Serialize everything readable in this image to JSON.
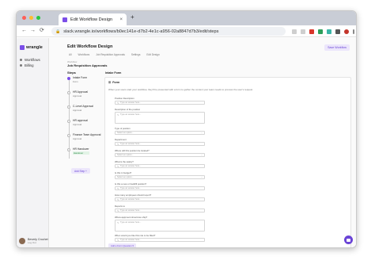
{
  "browser": {
    "tab_title": "Edit Workflow Design",
    "tab_close": "×",
    "new_tab": "+",
    "url": "slack.wrangle.io/workflows/b0ec141e-d7b2-4e1c-a956-02a8847d7b3/edit/steps",
    "back": "←",
    "forward": "→",
    "reload": "⟳",
    "lock": "🔒",
    "colors": {
      "red": "#fe5f57",
      "yellow": "#febc2e",
      "green": "#28c840"
    }
  },
  "sidebar": {
    "logo": "wrangle",
    "items": [
      {
        "label": "Workflows"
      },
      {
        "label": "Billing"
      }
    ],
    "user": {
      "name": "Beverly Crochet",
      "subtitle": "Log Out"
    }
  },
  "header": {
    "title": "Edit Workflow Design",
    "save_label": "Save Workflow",
    "breadcrumbs": [
      "All",
      "Workflows",
      "Job Requisition Approvals",
      "Settings",
      "Edit Design"
    ],
    "workflow_label": "Workflow",
    "workflow_name": "Job Requisition Approvals"
  },
  "steps": {
    "heading": "Steps",
    "items": [
      {
        "name": "Intake Form",
        "tag": "Form"
      },
      {
        "name": "HR Approval",
        "tag": "Approval"
      },
      {
        "name": "C-Level Approval",
        "tag": "Approval"
      },
      {
        "name": "HR approval",
        "tag": "Approval"
      },
      {
        "name": "Finance Team Approval",
        "tag": "Approval"
      },
      {
        "name": "HR Handover",
        "tag": "Handover"
      }
    ],
    "add_label": "Add Step +"
  },
  "panel": {
    "title": "Intake Form",
    "card_title": "Form",
    "description": "When your users start your workflow, they'll be presented with a form to gather the context your team needs to process the user's request.",
    "add_field_label": "Add a Form Question ▾",
    "questions": [
      {
        "label": "Position Description",
        "placeholder": "Type an answer here...",
        "kind": "text"
      },
      {
        "label": "Description of the position",
        "placeholder": "Type an answer here...",
        "kind": "area"
      },
      {
        "label": "Type of position",
        "placeholder": "Select an option...",
        "kind": "select"
      },
      {
        "label": "Department",
        "placeholder": "Type an answer here...",
        "kind": "text"
      },
      {
        "label": "Where will this position be located?",
        "placeholder": "Select an option...",
        "kind": "select"
      },
      {
        "label": "What is the salary?",
        "placeholder": "Type an answer here...",
        "kind": "text"
      },
      {
        "label": "Is this in budget?",
        "placeholder": "Select an option...",
        "kind": "select"
      },
      {
        "label": "Is this a new or backfill position?",
        "placeholder": "Type an answer here...",
        "kind": "text"
      },
      {
        "label": "How many employees should report?",
        "placeholder": "Type an answer here...",
        "kind": "text"
      },
      {
        "label": "Reports to",
        "placeholder": "Type an answer here...",
        "kind": "text"
      },
      {
        "label": "What equipment should we ship?",
        "placeholder": "Type an answer here...",
        "kind": "area"
      },
      {
        "label": "When would you like this role to be filled?",
        "placeholder": "Type an answer here...",
        "kind": "text"
      }
    ]
  }
}
